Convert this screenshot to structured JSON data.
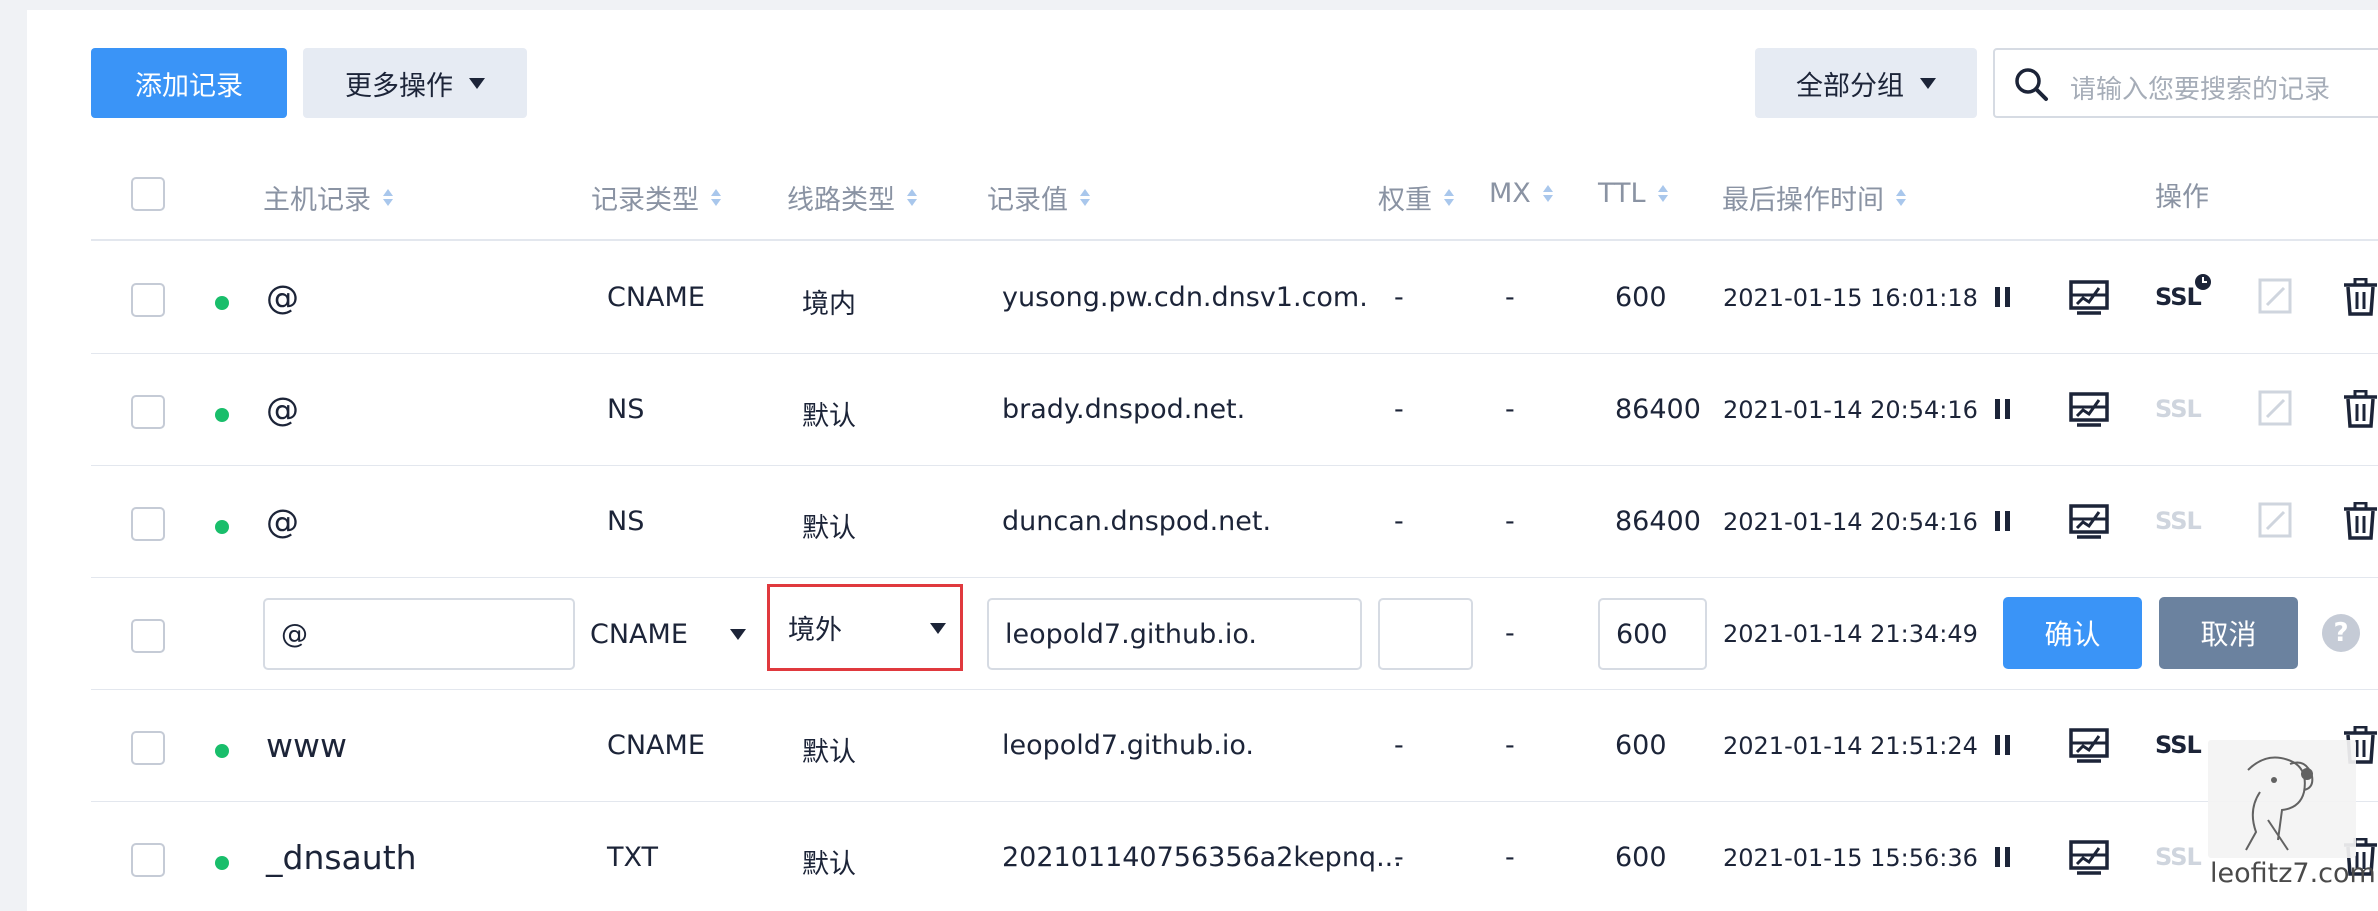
{
  "toolbar": {
    "add_record": "添加记录",
    "more_actions": "更多操作",
    "all_groups": "全部分组",
    "search_placeholder": "请输入您要搜索的记录"
  },
  "columns": {
    "host": "主机记录",
    "type": "记录类型",
    "line": "线路类型",
    "value": "记录值",
    "weight": "权重",
    "mx": "MX",
    "ttl": "TTL",
    "updated": "最后操作时间",
    "actions": "操作"
  },
  "rows": [
    {
      "host": "@",
      "type": "CNAME",
      "line": "境内",
      "value": "yusong.pw.cdn.dnsv1.com.",
      "weight": "-",
      "mx": "-",
      "ttl": "600",
      "updated": "2021-01-15 16:01:18",
      "ssl": "SSL",
      "ssl_enabled": true
    },
    {
      "host": "@",
      "type": "NS",
      "line": "默认",
      "value": "brady.dnspod.net.",
      "weight": "-",
      "mx": "-",
      "ttl": "86400",
      "updated": "2021-01-14 20:54:16",
      "ssl": "SSL",
      "ssl_enabled": false
    },
    {
      "host": "@",
      "type": "NS",
      "line": "默认",
      "value": "duncan.dnspod.net.",
      "weight": "-",
      "mx": "-",
      "ttl": "86400",
      "updated": "2021-01-14 20:54:16",
      "ssl": "SSL",
      "ssl_enabled": false
    },
    {
      "host": "www",
      "type": "CNAME",
      "line": "默认",
      "value": "leopold7.github.io.",
      "weight": "-",
      "mx": "-",
      "ttl": "600",
      "updated": "2021-01-14 21:51:24",
      "ssl": "SSL",
      "ssl_enabled": true
    },
    {
      "host": "_dnsauth",
      "type": "TXT",
      "line": "默认",
      "value": "202101140756356a2kepnq...",
      "weight": "-",
      "mx": "-",
      "ttl": "600",
      "updated": "2021-01-15 15:56:36",
      "ssl": "SSL",
      "ssl_enabled": false
    }
  ],
  "edit_row": {
    "host": "@",
    "type": "CNAME",
    "line": "境外",
    "value": "leopold7.github.io.",
    "weight": "",
    "mx": "-",
    "ttl": "600",
    "updated": "2021-01-14 21:34:49",
    "confirm": "确认",
    "cancel": "取消",
    "help": "?"
  },
  "watermark": "leofitz7.com",
  "colors": {
    "primary": "#3a94f7",
    "status_dot": "#19be6b",
    "highlight_border": "#e0393e",
    "cancel": "#6b829f"
  }
}
